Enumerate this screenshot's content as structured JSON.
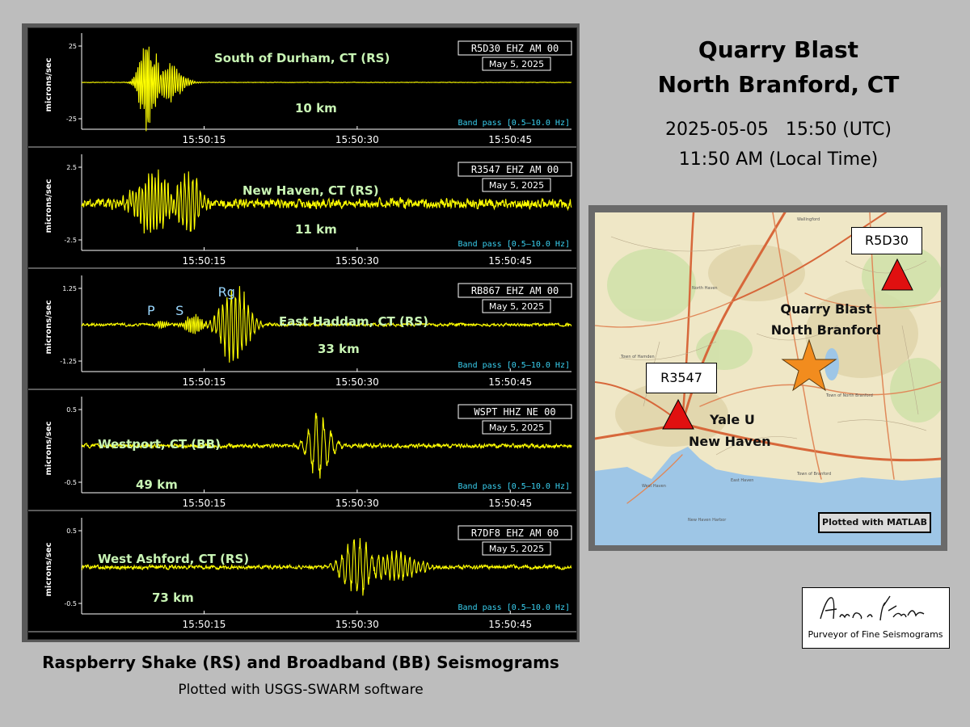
{
  "title": {
    "line1": "Quarry Blast",
    "line2": "North Branford, CT"
  },
  "time": {
    "utc": "2025-05-05   15:50 (UTC)",
    "local": "11:50 AM (Local Time)"
  },
  "caption": {
    "main": "Raspberry Shake (RS) and Broadband (BB) Seismograms",
    "sub": "Plotted with USGS-SWARM software"
  },
  "colors": {
    "trace": "#ffff00",
    "background": "#000000",
    "station_label": "#c8f5b4",
    "bandpass": "#39d0f0",
    "epicenter": "#f28c1e",
    "station_marker": "#e01010"
  },
  "chart_data": [
    {
      "type": "line",
      "station": "South of Durham, CT (RS)",
      "distance": "10 km",
      "channel": "R5D30 EHZ AM 00",
      "date": "May 5, 2025",
      "filter": "Band pass [0.5–10.0 Hz]",
      "ylabel": "microns/sec",
      "ylim": [
        -25,
        25
      ],
      "ytick_labels": [
        "25",
        "-25"
      ],
      "xtick_labels": [
        "15:50:15",
        "15:50:30",
        "15:50:45"
      ],
      "time_range_s": [
        3,
        51
      ],
      "waveform": {
        "noise": 0.01,
        "packets": [
          {
            "t": 9.4,
            "amp": 1.15,
            "w": 0.9,
            "f": 5.5
          },
          {
            "t": 11.5,
            "amp": 0.45,
            "w": 1.6,
            "f": 4.5
          }
        ]
      },
      "phases": []
    },
    {
      "type": "line",
      "station": "New Haven, CT (RS)",
      "distance": "11 km",
      "channel": "R3547 EHZ AM 00",
      "date": "May 5, 2025",
      "filter": "Band pass [0.5–10.0 Hz]",
      "ylabel": "microns/sec",
      "ylim": [
        -2.5,
        2.5
      ],
      "ytick_labels": [
        "2.5",
        "-2.5"
      ],
      "xtick_labels": [
        "15:50:15",
        "15:50:30",
        "15:50:45"
      ],
      "time_range_s": [
        3,
        51
      ],
      "waveform": {
        "noise": 0.2,
        "packets": [
          {
            "t": 10,
            "amp": 0.75,
            "w": 2.0,
            "f": 3.2
          },
          {
            "t": 13.6,
            "amp": 0.85,
            "w": 1.1,
            "f": 2.6
          }
        ]
      },
      "phases": []
    },
    {
      "type": "line",
      "station": "East Haddam, CT (RS)",
      "distance": "33 km",
      "channel": "RB867 EHZ AM 00",
      "date": "May 5, 2025",
      "filter": "Band pass [0.5–10.0 Hz]",
      "ylabel": "microns/sec",
      "ylim": [
        -1.25,
        1.25
      ],
      "ytick_labels": [
        "1.25",
        "-1.25"
      ],
      "xtick_labels": [
        "15:50:15",
        "15:50:30",
        "15:50:45"
      ],
      "time_range_s": [
        3,
        51
      ],
      "waveform": {
        "noise": 0.06,
        "packets": [
          {
            "t": 10.8,
            "amp": 0.12,
            "w": 0.6,
            "f": 5
          },
          {
            "t": 14,
            "amp": 0.28,
            "w": 0.9,
            "f": 5
          },
          {
            "t": 18,
            "amp": 1.05,
            "w": 1.6,
            "f": 2.4
          }
        ]
      },
      "phases": [
        {
          "label": "P",
          "t": 9.8
        },
        {
          "label": "S",
          "t": 12.6
        },
        {
          "label": "Rg",
          "t": 17.2
        }
      ]
    },
    {
      "type": "line",
      "station": "Westport, CT (BB)",
      "distance": "49 km",
      "channel": "WSPT HHZ NE 00",
      "date": "May 5, 2025",
      "filter": "Band pass [0.5–10.0 Hz]",
      "ylabel": "microns/sec",
      "ylim": [
        -0.5,
        0.5
      ],
      "ytick_labels": [
        "0.5",
        "-0.5"
      ],
      "xtick_labels": [
        "15:50:15",
        "15:50:30",
        "15:50:45"
      ],
      "time_range_s": [
        3,
        51
      ],
      "waveform": {
        "noise": 0.08,
        "packets": [
          {
            "t": 26.3,
            "amp": 0.82,
            "w": 1.3,
            "f": 1.35
          }
        ]
      },
      "phases": []
    },
    {
      "type": "line",
      "station": "West Ashford, CT (RS)",
      "distance": "73 km",
      "channel": "R7DF8 EHZ AM 00",
      "date": "May 5, 2025",
      "filter": "Band pass [0.5–10.0 Hz]",
      "ylabel": "microns/sec",
      "ylim": [
        -0.5,
        0.5
      ],
      "ytick_labels": [
        "0.5",
        "-0.5"
      ],
      "xtick_labels": [
        "15:50:15",
        "15:50:30",
        "15:50:45"
      ],
      "time_range_s": [
        3,
        51
      ],
      "waveform": {
        "noise": 0.08,
        "packets": [
          {
            "t": 30,
            "amp": 0.7,
            "w": 1.8,
            "f": 1.7
          },
          {
            "t": 34,
            "amp": 0.35,
            "w": 2.2,
            "f": 2.3
          }
        ]
      },
      "phases": []
    }
  ],
  "map": {
    "stations": [
      {
        "id": "R5D30"
      },
      {
        "id": "R3547"
      }
    ],
    "labels": {
      "blast": [
        "Quarry Blast",
        "North Branford"
      ],
      "city": [
        "Yale U",
        "New Haven"
      ]
    },
    "credit": "Plotted with MATLAB",
    "towns": [
      "North Haven",
      "Town of Hamden",
      "Town of North Branford",
      "New Haven Harbor",
      "West Haven",
      "East Haven",
      "Town of Branford",
      "Wallingford"
    ]
  },
  "signature": {
    "name": "Alan L. Kafka",
    "tagline": "Purveyor of Fine Seismograms"
  }
}
